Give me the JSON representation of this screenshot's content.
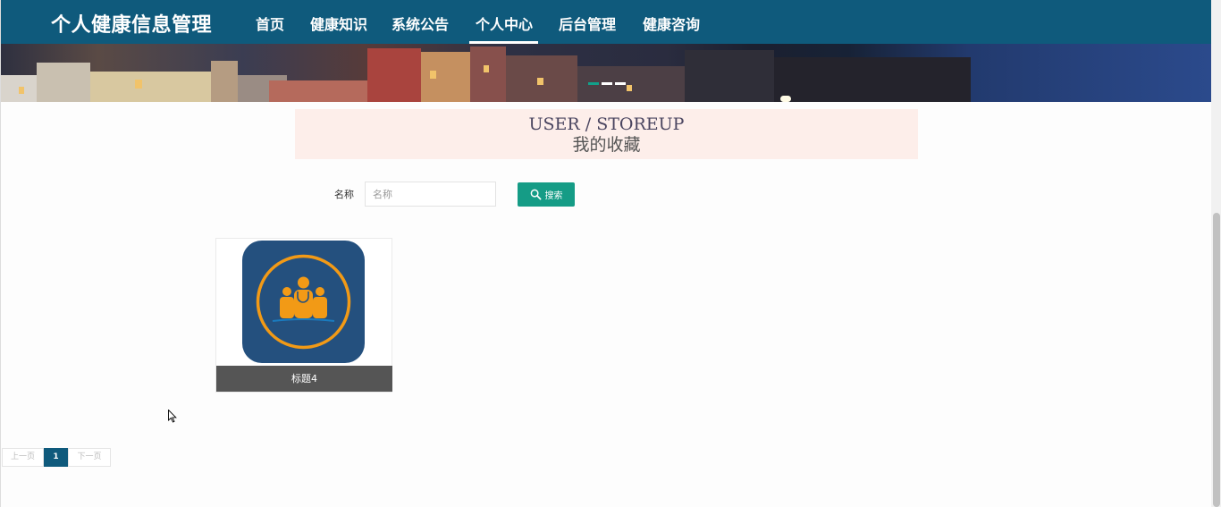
{
  "nav": {
    "brand": "个人健康信息管理",
    "items": [
      {
        "label": "首页",
        "active": false
      },
      {
        "label": "健康知识",
        "active": false
      },
      {
        "label": "系统公告",
        "active": false
      },
      {
        "label": "个人中心",
        "active": true
      },
      {
        "label": "后台管理",
        "active": false
      },
      {
        "label": "健康咨询",
        "active": false
      }
    ]
  },
  "colors": {
    "nav_bg": "#0f5a7c",
    "title_bg": "#fdeeea",
    "search_button": "#159c86",
    "card_caption_bg": "#555555",
    "pager_active": "#0f5a7c"
  },
  "section": {
    "title_en": "USER / STOREUP",
    "title_cn": "我的收藏"
  },
  "search": {
    "label": "名称",
    "placeholder": "名称",
    "value": "",
    "button_label": "搜索",
    "button_icon": "search-icon"
  },
  "favorites": [
    {
      "caption": "标题4",
      "image_icon": "medical-team-icon"
    }
  ],
  "pagination": {
    "prev_label": "上一页",
    "current_page": "1",
    "next_label": "下一页"
  }
}
